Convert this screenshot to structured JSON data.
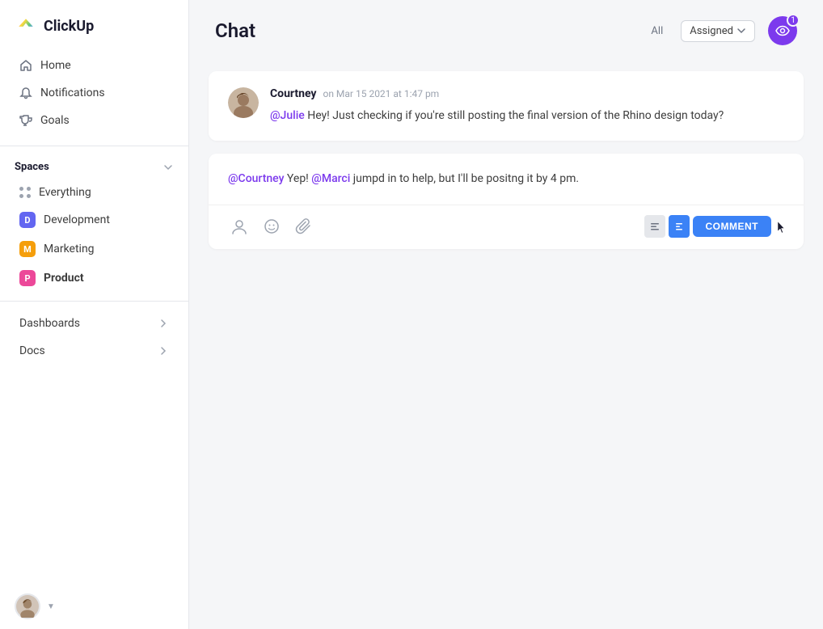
{
  "app": {
    "name": "ClickUp"
  },
  "sidebar": {
    "nav_items": [
      {
        "id": "home",
        "label": "Home",
        "icon": "home-icon"
      },
      {
        "id": "notifications",
        "label": "Notifications",
        "icon": "bell-icon"
      },
      {
        "id": "goals",
        "label": "Goals",
        "icon": "trophy-icon"
      }
    ],
    "spaces_section": {
      "label": "Spaces",
      "items": [
        {
          "id": "everything",
          "label": "Everything",
          "icon": "dots-icon"
        },
        {
          "id": "development",
          "label": "Development",
          "badge": "D",
          "color": "#6366f1"
        },
        {
          "id": "marketing",
          "label": "Marketing",
          "badge": "M",
          "color": "#f59e0b"
        },
        {
          "id": "product",
          "label": "Product",
          "badge": "P",
          "color": "#ec4899",
          "active": true
        }
      ]
    },
    "footer_items": [
      {
        "id": "dashboards",
        "label": "Dashboards"
      },
      {
        "id": "docs",
        "label": "Docs"
      }
    ]
  },
  "chat": {
    "title": "Chat",
    "filter_all": "All",
    "filter_assigned": "Assigned",
    "watch_count": "1",
    "messages": [
      {
        "id": "msg1",
        "author": "Courtney",
        "time": "on Mar 15 2021 at 1:47 pm",
        "mention": "@Julie",
        "text": " Hey! Just checking if you're still posting the final version of the Rhino design today?"
      }
    ],
    "reply": {
      "mention1": "@Courtney",
      "text1": " Yep! ",
      "mention2": "@Marci",
      "text2": " jumpd in to help, but I'll be positng it by 4 pm."
    },
    "toolbar": {
      "comment_label": "COMMENT"
    }
  }
}
